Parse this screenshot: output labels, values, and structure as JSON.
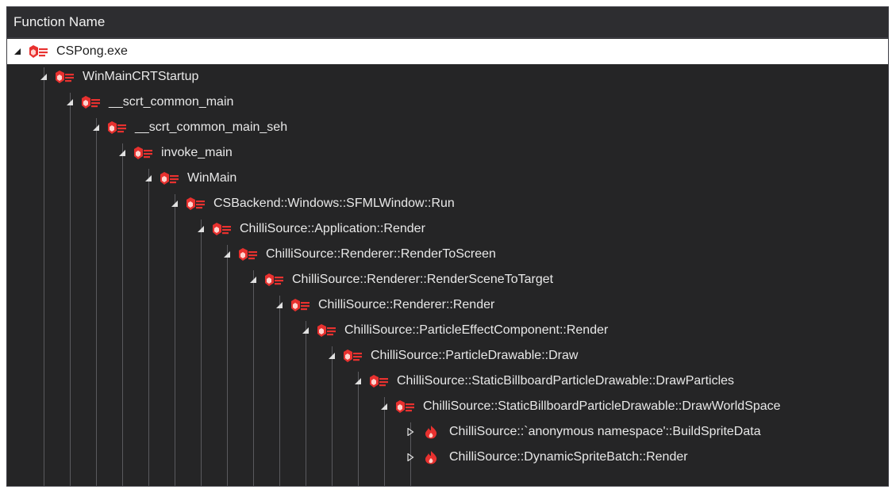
{
  "header": {
    "column_label": "Function Name"
  },
  "tree": {
    "nodes": [
      {
        "label": "CSPong.exe",
        "depth": 0,
        "expander": "expanded",
        "icon": "function-icon",
        "selected": true
      },
      {
        "label": "WinMainCRTStartup",
        "depth": 1,
        "expander": "expanded",
        "icon": "function-icon"
      },
      {
        "label": "__scrt_common_main",
        "depth": 2,
        "expander": "expanded",
        "icon": "function-icon"
      },
      {
        "label": "__scrt_common_main_seh",
        "depth": 3,
        "expander": "expanded",
        "icon": "function-icon"
      },
      {
        "label": "invoke_main",
        "depth": 4,
        "expander": "expanded",
        "icon": "function-icon"
      },
      {
        "label": "WinMain",
        "depth": 5,
        "expander": "expanded",
        "icon": "function-icon"
      },
      {
        "label": "CSBackend::Windows::SFMLWindow::Run",
        "depth": 6,
        "expander": "expanded",
        "icon": "function-icon"
      },
      {
        "label": "ChilliSource::Application::Render",
        "depth": 7,
        "expander": "expanded",
        "icon": "function-icon"
      },
      {
        "label": "ChilliSource::Renderer::RenderToScreen",
        "depth": 8,
        "expander": "expanded",
        "icon": "function-icon"
      },
      {
        "label": "ChilliSource::Renderer::RenderSceneToTarget",
        "depth": 9,
        "expander": "expanded",
        "icon": "function-icon"
      },
      {
        "label": "ChilliSource::Renderer::Render",
        "depth": 10,
        "expander": "expanded",
        "icon": "function-icon"
      },
      {
        "label": "ChilliSource::ParticleEffectComponent::Render",
        "depth": 11,
        "expander": "expanded",
        "icon": "function-icon"
      },
      {
        "label": "ChilliSource::ParticleDrawable::Draw",
        "depth": 12,
        "expander": "expanded",
        "icon": "function-icon"
      },
      {
        "label": "ChilliSource::StaticBillboardParticleDrawable::DrawParticles",
        "depth": 13,
        "expander": "expanded",
        "icon": "function-icon"
      },
      {
        "label": "ChilliSource::StaticBillboardParticleDrawable::DrawWorldSpace",
        "depth": 14,
        "expander": "expanded",
        "icon": "function-icon"
      },
      {
        "label": "ChilliSource::`anonymous namespace'::BuildSpriteData",
        "depth": 15,
        "expander": "collapsed",
        "icon": "hot-path-icon"
      },
      {
        "label": "ChilliSource::DynamicSpriteBatch::Render",
        "depth": 15,
        "expander": "collapsed",
        "icon": "hot-path-icon"
      }
    ]
  },
  "colors": {
    "background": "#252526",
    "header_background": "#2d2d30",
    "text": "#e8e8e8",
    "selected_row": "#ffffff",
    "icon_red": "#e8312f",
    "guide_line": "#5a5a5e"
  }
}
